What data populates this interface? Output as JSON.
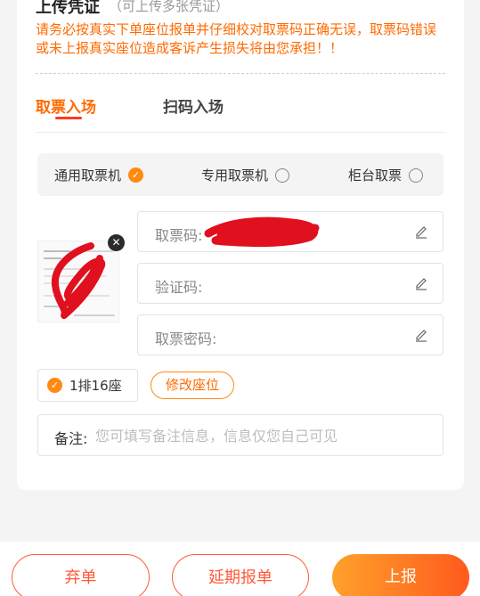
{
  "upload": {
    "title": "上传凭证",
    "subtitle": "（可上传多张凭证）",
    "warning": "请务必按真实下单座位报单并仔细校对取票码正确无误，取票码错误或未上报真实座位造成客诉产生损失将由您承担！！"
  },
  "tabs": [
    {
      "label": "取票入场",
      "active": true
    },
    {
      "label": "扫码入场",
      "active": false
    }
  ],
  "modes": [
    {
      "label": "通用取票机",
      "selected": true
    },
    {
      "label": "专用取票机",
      "selected": false
    },
    {
      "label": "柜台取票",
      "selected": false
    }
  ],
  "fields": {
    "ticket_code": "取票码:",
    "verify_code": "验证码:",
    "ticket_password": "取票密码:"
  },
  "seat": {
    "label": "1排16座",
    "modify_button": "修改座位"
  },
  "note": {
    "label": "备注:",
    "placeholder": "您可填写备注信息，信息仅您自己可见"
  },
  "actions": {
    "abandon": "弃单",
    "delay": "延期报单",
    "submit": "上报"
  },
  "colors": {
    "accent": "#ff6a00",
    "tab_underline": "#ff3a1e",
    "button_outline": "#ff5a3a"
  }
}
